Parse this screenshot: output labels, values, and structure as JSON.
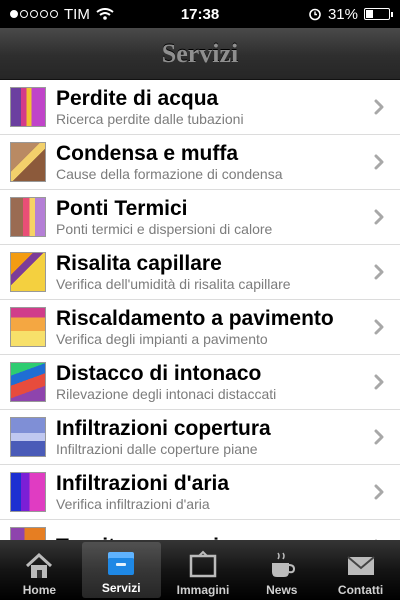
{
  "status": {
    "carrier": "TIM",
    "time": "17:38",
    "battery": "31%",
    "signal_bars": 1,
    "battery_level": 0.31
  },
  "nav": {
    "title": "Servizi"
  },
  "services": [
    {
      "title": "Perdite di acqua",
      "subtitle": "Ricerca perdite dalle tubazioni"
    },
    {
      "title": "Condensa e muffa",
      "subtitle": "Cause della formazione di condensa"
    },
    {
      "title": "Ponti Termici",
      "subtitle": "Ponti termici e dispersioni di calore"
    },
    {
      "title": "Risalita capillare",
      "subtitle": "Verifica dell'umidità di risalita capillare"
    },
    {
      "title": "Riscaldamento a pavimento",
      "subtitle": "Verifica degli impianti a pavimento"
    },
    {
      "title": "Distacco di intonaco",
      "subtitle": "Rilevazione degli intonaci distaccati"
    },
    {
      "title": "Infiltrazioni copertura",
      "subtitle": "Infiltrazioni dalle coperture piane"
    },
    {
      "title": "Infiltrazioni d'aria",
      "subtitle": "Verifica infiltrazioni d'aria"
    },
    {
      "title": "Tessitura muraria",
      "subtitle": ""
    }
  ],
  "tabs": [
    {
      "label": "Home",
      "icon": "house-icon"
    },
    {
      "label": "Servizi",
      "icon": "tray-icon"
    },
    {
      "label": "Immagini",
      "icon": "picture-icon"
    },
    {
      "label": "News",
      "icon": "cup-icon"
    },
    {
      "label": "Contatti",
      "icon": "envelope-icon"
    }
  ],
  "active_tab": "Servizi"
}
